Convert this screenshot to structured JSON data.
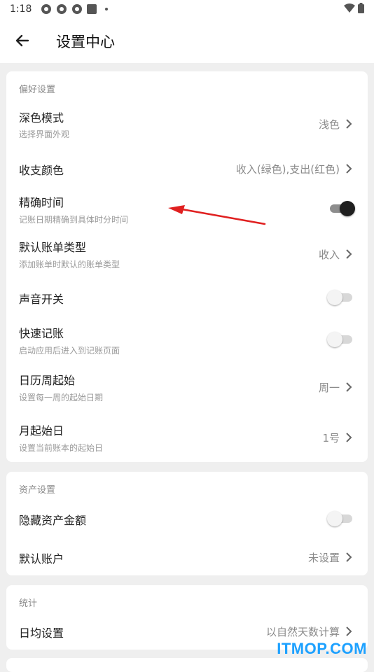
{
  "status_bar": {
    "time": "1:18"
  },
  "header": {
    "title": "设置中心"
  },
  "sections": [
    {
      "title": "偏好设置",
      "rows": [
        {
          "title": "深色模式",
          "subtitle": "选择界面外观",
          "value": "浅色"
        },
        {
          "title": "收支颜色",
          "value": "收入(绿色),支出(红色)"
        },
        {
          "title": "精确时间",
          "subtitle": "记账日期精确到具体时分时间",
          "toggle": true
        },
        {
          "title": "默认账单类型",
          "subtitle": "添加账单时默认的账单类型",
          "value": "收入"
        },
        {
          "title": "声音开关",
          "toggle": false
        },
        {
          "title": "快速记账",
          "subtitle": "启动应用后进入到记账页面",
          "toggle": false
        },
        {
          "title": "日历周起始",
          "subtitle": "设置每一周的起始日期",
          "value": "周一"
        },
        {
          "title": "月起始日",
          "subtitle": "设置当前账本的起始日",
          "value": "1号"
        }
      ]
    },
    {
      "title": "资产设置",
      "rows": [
        {
          "title": "隐藏资产金额",
          "toggle": false
        },
        {
          "title": "默认账户",
          "value": "未设置"
        }
      ]
    },
    {
      "title": "统计",
      "rows": [
        {
          "title": "日均设置",
          "value": "以自然天数计算"
        }
      ]
    }
  ],
  "watermark": "ITMOP.COM",
  "colors": {
    "annotation_arrow": "#e02020",
    "watermark": "#1da1ff",
    "toggle_on": "#1f1f1f"
  }
}
